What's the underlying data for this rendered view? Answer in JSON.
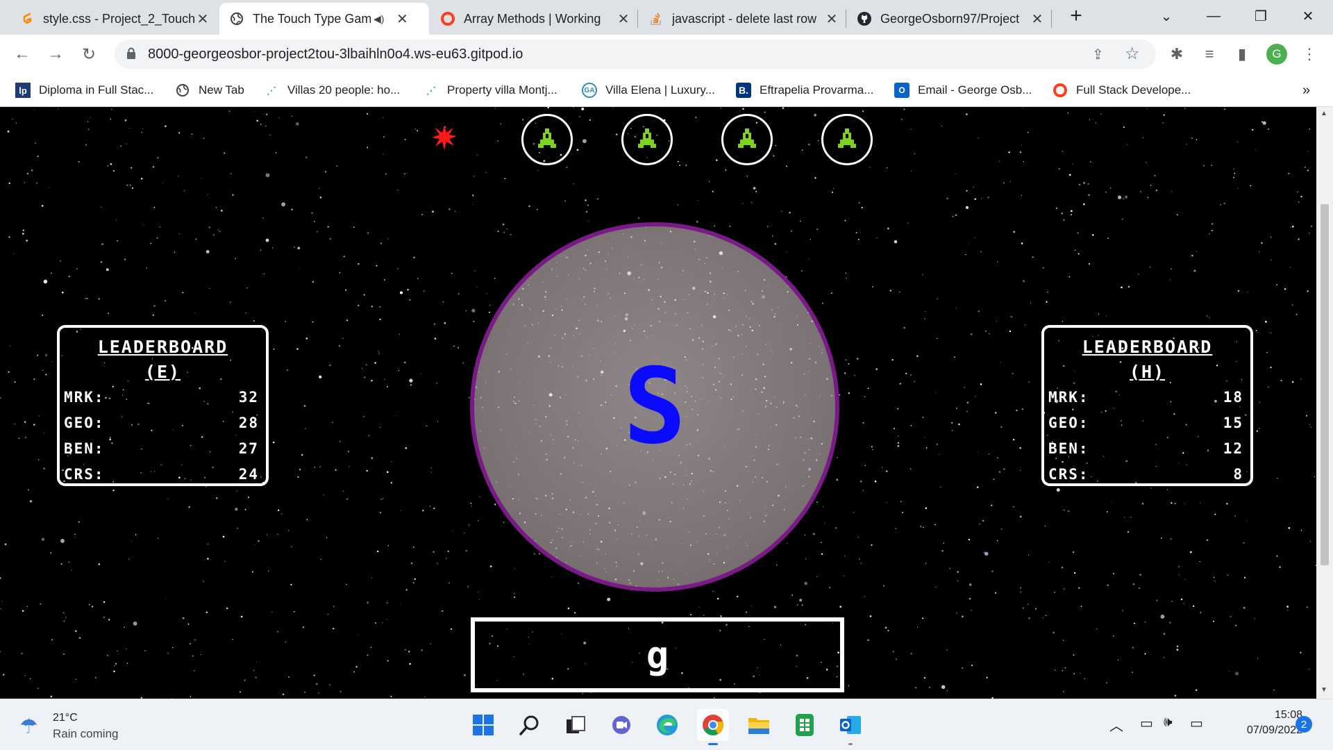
{
  "browser": {
    "tabs": [
      {
        "title": "style.css - Project_2_Touch",
        "icon": "gitpod-icon",
        "active": false
      },
      {
        "title": "The Touch Type Game",
        "icon": "globe-icon",
        "active": true,
        "audio": true
      },
      {
        "title": "Array Methods | Working",
        "icon": "opera-icon",
        "active": false
      },
      {
        "title": "javascript - delete last row",
        "icon": "stackoverflow-icon",
        "active": false
      },
      {
        "title": "GeorgeOsborn97/Project",
        "icon": "github-icon",
        "active": false
      }
    ],
    "new_tab_symbol": "+",
    "address": "8000-georgeosbor-project2tou-3lbaihln0o4.ws-eu63.gitpod.io",
    "profile_initial": "G",
    "bookmarks": [
      {
        "label": "Diploma in Full Stac...",
        "icon": "lp-icon"
      },
      {
        "label": "New Tab",
        "icon": "globe-icon"
      },
      {
        "label": "Villas 20 people: ho...",
        "icon": "sparkle-icon"
      },
      {
        "label": "Property villa Montj...",
        "icon": "sparkle-icon"
      },
      {
        "label": "Villa Elena | Luxury...",
        "icon": "ga-icon"
      },
      {
        "label": "Eftrapelia Provarma...",
        "icon": "booking-icon"
      },
      {
        "label": "Email - George Osb...",
        "icon": "outlook-icon"
      },
      {
        "label": "Full Stack Develope...",
        "icon": "opera-icon"
      }
    ],
    "bookmarks_overflow": "»"
  },
  "game": {
    "lives": [
      "explosion",
      "ship",
      "ship",
      "ship",
      "ship"
    ],
    "leaderboard_easy": {
      "title": "LEADERBOARD",
      "subtitle": "(E)",
      "rows": [
        {
          "name": "MRK:",
          "score": "32"
        },
        {
          "name": "GEO:",
          "score": "28"
        },
        {
          "name": "BEN:",
          "score": "27"
        },
        {
          "name": "CRS:",
          "score": "24"
        }
      ]
    },
    "leaderboard_hard": {
      "title": "LEADERBOARD",
      "subtitle": "(H)",
      "rows": [
        {
          "name": "MRK:",
          "score": "18"
        },
        {
          "name": "GEO:",
          "score": "15"
        },
        {
          "name": "BEN:",
          "score": "12"
        },
        {
          "name": "CRS:",
          "score": "8"
        }
      ]
    },
    "target_letter": "S",
    "typed_input": "g",
    "colors": {
      "planet_border": "#7a1a86",
      "target_letter": "#0a0aff",
      "ship": "#7dd321",
      "explosion": "#ff1a1a"
    }
  },
  "taskbar": {
    "weather_temp": "21°C",
    "weather_desc": "Rain coming",
    "time": "15:08",
    "date": "07/09/2022",
    "notification_count": "2"
  }
}
